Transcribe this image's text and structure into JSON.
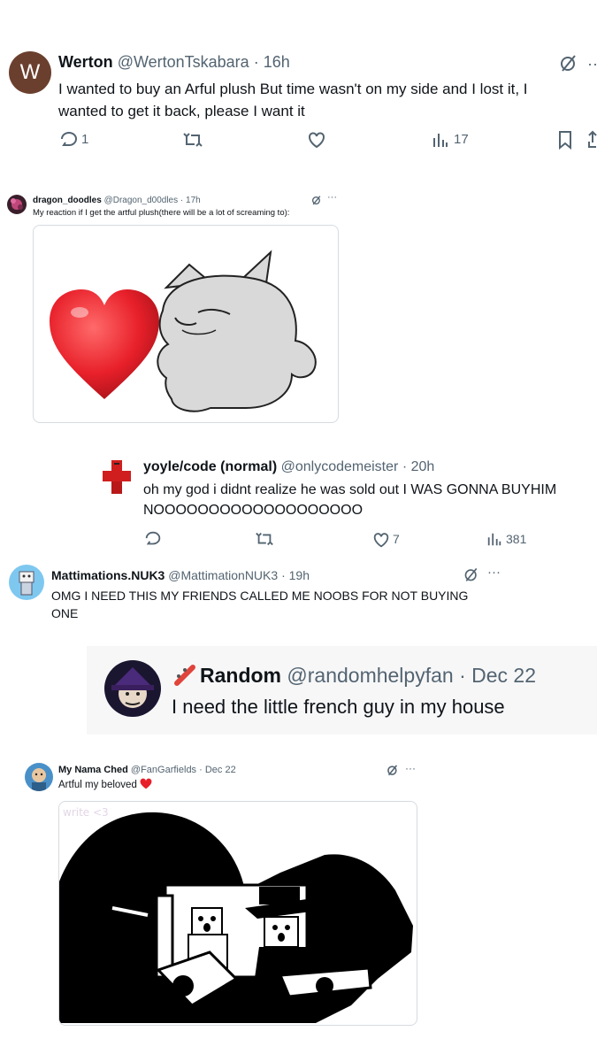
{
  "tweet1": {
    "name": "Werton",
    "handle": "@WertonTskabara",
    "time": "16h",
    "avatar_letter": "W",
    "text": "I wanted to buy an Arful plush But time wasn't on my side and I lost it, I wanted to get it back, please I want it",
    "reply_count": "1",
    "views_count": "17"
  },
  "tweet2": {
    "name": "dragon_doodles",
    "handle": "@Dragon_d00dles",
    "time": "17h",
    "text": "My reaction if I get the artful plush(there will be a lot of screaming to):",
    "image_alt": "heart-and-plush-drawing"
  },
  "tweet3": {
    "name": "yoyle/code (normal)",
    "handle": "@onlycodemeister",
    "time": "20h",
    "text_line1": "oh my god i didnt realize he was sold out I WAS GONNA BUYHIM",
    "text_line2": "NOOOOOOOOOOOOOOOOOOO",
    "like_count": "7",
    "views_count": "381"
  },
  "tweet4": {
    "name": "Mattimations.NUK3",
    "handle": "@MattimationNUK3",
    "time": "19h",
    "text": "OMG I NEED THIS MY FRIENDS CALLED ME NOOBS FOR NOT BUYING ONE"
  },
  "tweet5": {
    "name": "Random",
    "handle": "@randomhelpyfan",
    "time": "Dec 22",
    "text": "I need the little french guy in my house"
  },
  "tweet6": {
    "name": "My Nama Ched",
    "handle": "@FanGarfields",
    "time": "Dec 22",
    "text": "Artful my beloved",
    "sketch_text": "write <3"
  },
  "separator": "·",
  "icons": {
    "grok": "grok-icon",
    "more": "more-icon",
    "reply": "reply-icon",
    "retweet": "retweet-icon",
    "like": "like-icon",
    "views": "views-icon",
    "bookmark": "bookmark-icon",
    "share": "share-icon"
  },
  "colors": {
    "text": "#0f1419",
    "muted": "#536471",
    "heart": "#e8202a",
    "quote_bg": "#f7f7f8"
  }
}
